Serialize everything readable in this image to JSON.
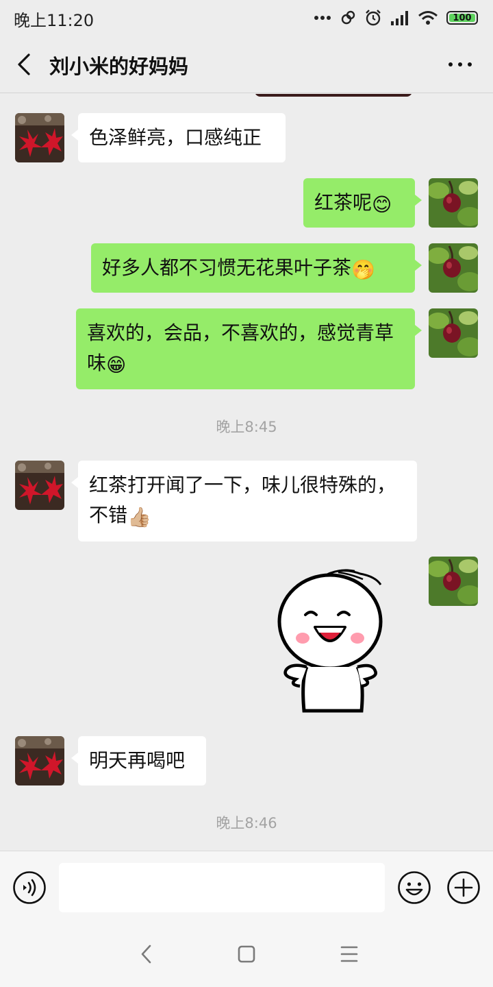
{
  "status_bar": {
    "time": "晚上11:20",
    "battery": "100"
  },
  "header": {
    "title": "刘小米的好妈妈"
  },
  "messages": [
    {
      "side": "in",
      "text": "色泽鲜亮，口感纯正"
    },
    {
      "side": "out",
      "text": "红茶呢",
      "emoji": "😊"
    },
    {
      "side": "out",
      "text": "好多人都不习惯无花果叶子茶",
      "emoji": "🤭"
    },
    {
      "side": "out",
      "line1": "喜欢的，会品，不喜欢的，感觉青草",
      "line2": "味",
      "emoji": "😁"
    },
    {
      "side": "in",
      "line1": "红茶打开闻了一下，味儿很特殊的，",
      "line2": "不错",
      "emoji": "👍🏼"
    },
    {
      "side": "out",
      "type": "sticker",
      "sticker": "smiling-stick-figure"
    },
    {
      "side": "in",
      "text": "明天再喝吧"
    }
  ],
  "timestamps": [
    "晚上8:45",
    "晚上8:46"
  ],
  "input_bar": {
    "placeholder": ""
  },
  "colors": {
    "outgoing_bubble": "#95ec69",
    "incoming_bubble": "#ffffff",
    "background": "#ededed"
  }
}
